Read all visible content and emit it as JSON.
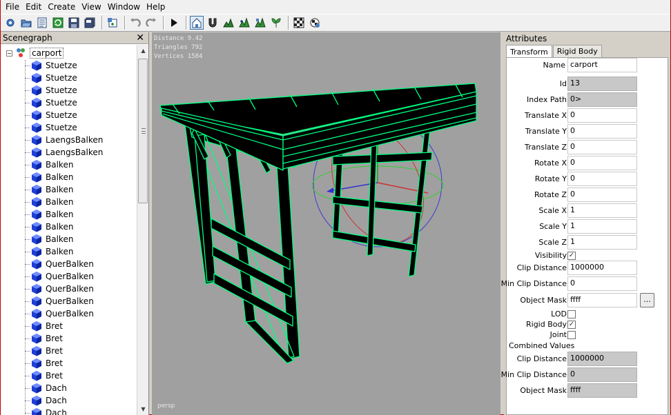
{
  "menu": [
    "File",
    "Edit",
    "Create",
    "View",
    "Window",
    "Help"
  ],
  "toolbar": {
    "groups": [
      [
        "settings-icon",
        "open-icon",
        "list-icon",
        "refresh-icon",
        "save-icon",
        "save-all-icon"
      ],
      [
        "add-node-icon"
      ],
      [
        "undo-icon",
        "redo-icon"
      ],
      [
        "play-icon"
      ],
      [
        "home-icon",
        "magnet-icon",
        "terrain-icon",
        "terrain-add-icon",
        "terrain-edit-icon",
        "plant-icon"
      ],
      [
        "checker-icon",
        "checker-gear-icon"
      ]
    ]
  },
  "scenegraph": {
    "title": "Scenegraph",
    "close": "✕",
    "root": "carport",
    "items": [
      "Stuetze",
      "Stuetze",
      "Stuetze",
      "Stuetze",
      "Stuetze",
      "Stuetze",
      "LaengsBalken",
      "LaengsBalken",
      "Balken",
      "Balken",
      "Balken",
      "Balken",
      "Balken",
      "Balken",
      "Balken",
      "Balken",
      "QuerBalken",
      "QuerBalken",
      "QuerBalken",
      "QuerBalken",
      "QuerBalken",
      "Bret",
      "Bret",
      "Bret",
      "Bret",
      "Bret",
      "Dach",
      "Dach",
      "Dach"
    ]
  },
  "viewport": {
    "stats": [
      "Distance 9.42",
      "Triangles 792",
      "Vertices 1584"
    ],
    "camera": "persp",
    "colors": {
      "background": "#a0a0a0",
      "wire": "#00ff80"
    }
  },
  "attributes": {
    "title": "Attributes",
    "tabs": [
      "Transform",
      "Rigid Body"
    ],
    "name_label": "Name",
    "name_value": "carport",
    "id_label": "Id",
    "id_value": "13",
    "index_path_label": "Index Path",
    "index_path_value": "0>",
    "translate_x_label": "Translate X",
    "translate_x_value": "0",
    "translate_y_label": "Translate Y",
    "translate_y_value": "0",
    "translate_z_label": "Translate Z",
    "translate_z_value": "0",
    "rotate_x_label": "Rotate X",
    "rotate_x_value": "0",
    "rotate_y_label": "Rotate Y",
    "rotate_y_value": "0",
    "rotate_z_label": "Rotate Z",
    "rotate_z_value": "0",
    "scale_x_label": "Scale X",
    "scale_x_value": "1",
    "scale_y_label": "Scale Y",
    "scale_y_value": "1",
    "scale_z_label": "Scale Z",
    "scale_z_value": "1",
    "visibility_label": "Visibility",
    "visibility_checked": true,
    "clip_distance_label": "Clip Distance",
    "clip_distance_value": "1000000",
    "min_clip_distance_label": "Min Clip Distance",
    "min_clip_distance_value": "0",
    "object_mask_label": "Object Mask",
    "object_mask_value": "ffff",
    "browse_label": "...",
    "lod_label": "LOD",
    "lod_checked": false,
    "rigid_body_label": "Rigid Body",
    "rigid_body_checked": true,
    "joint_label": "Joint",
    "joint_checked": false,
    "combined_values_label": "Combined Values",
    "combined_clip_distance_label": "Clip Distance",
    "combined_clip_distance_value": "1000000",
    "combined_min_clip_distance_label": "Min Clip Distance",
    "combined_min_clip_distance_value": "0",
    "combined_object_mask_label": "Object Mask",
    "combined_object_mask_value": "ffff"
  }
}
